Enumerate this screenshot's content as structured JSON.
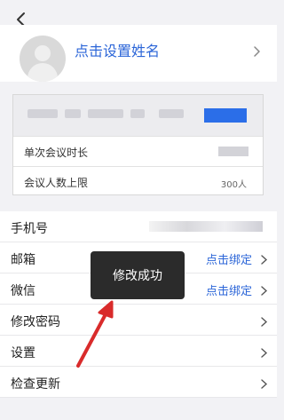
{
  "header": {
    "back_icon": "chevron-left-icon"
  },
  "profile": {
    "name_label": "点击设置姓名",
    "chevron": "›"
  },
  "meeting_card": {
    "rows": [
      {
        "label": "单次会议时长",
        "value": ""
      },
      {
        "label": "会议人数上限",
        "value": "300人"
      }
    ]
  },
  "settings_list": {
    "items": [
      {
        "label": "手机号",
        "action": "",
        "chevron": ""
      },
      {
        "label": "邮箱",
        "action": "点击绑定",
        "chevron": "›"
      },
      {
        "label": "微信",
        "action": "点击绑定",
        "chevron": "›"
      },
      {
        "label": "修改密码",
        "action": "",
        "chevron": "›"
      },
      {
        "label": "设置",
        "action": "",
        "chevron": "›"
      },
      {
        "label": "检查更新",
        "action": "",
        "chevron": "›"
      }
    ]
  },
  "toast": {
    "message": "修改成功"
  },
  "colors": {
    "accent": "#2c66d8",
    "annotation_arrow": "#d92b2b",
    "toast_bg": "#2b2b2b"
  }
}
